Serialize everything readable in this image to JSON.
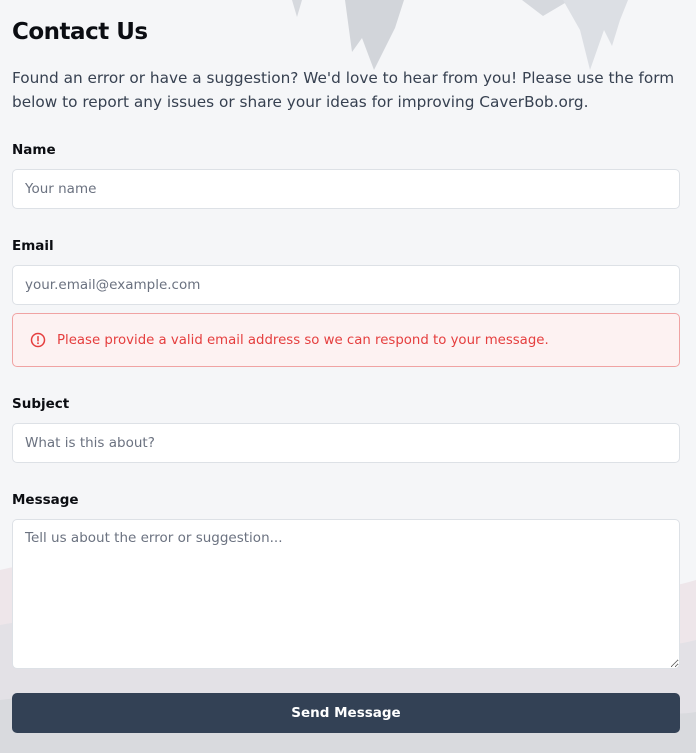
{
  "page": {
    "title": "Contact Us",
    "intro": "Found an error or have a suggestion? We'd love to hear from you! Please use the form below to report any issues or share your ideas for improving CaverBob.org."
  },
  "form": {
    "name": {
      "label": "Name",
      "placeholder": "Your name",
      "value": ""
    },
    "email": {
      "label": "Email",
      "placeholder": "your.email@example.com",
      "value": "",
      "error": "Please provide a valid email address so we can respond to your message."
    },
    "subject": {
      "label": "Subject",
      "placeholder": "What is this about?",
      "value": ""
    },
    "message": {
      "label": "Message",
      "placeholder": "Tell us about the error or suggestion...",
      "value": ""
    },
    "submit_label": "Send Message"
  },
  "colors": {
    "background": "#f5f6f8",
    "button": "#334155",
    "error_text": "#e53e3e",
    "error_border": "#f0a3a3",
    "error_background": "#fdf2f2"
  },
  "icons": {
    "error": "alert-circle-icon"
  }
}
